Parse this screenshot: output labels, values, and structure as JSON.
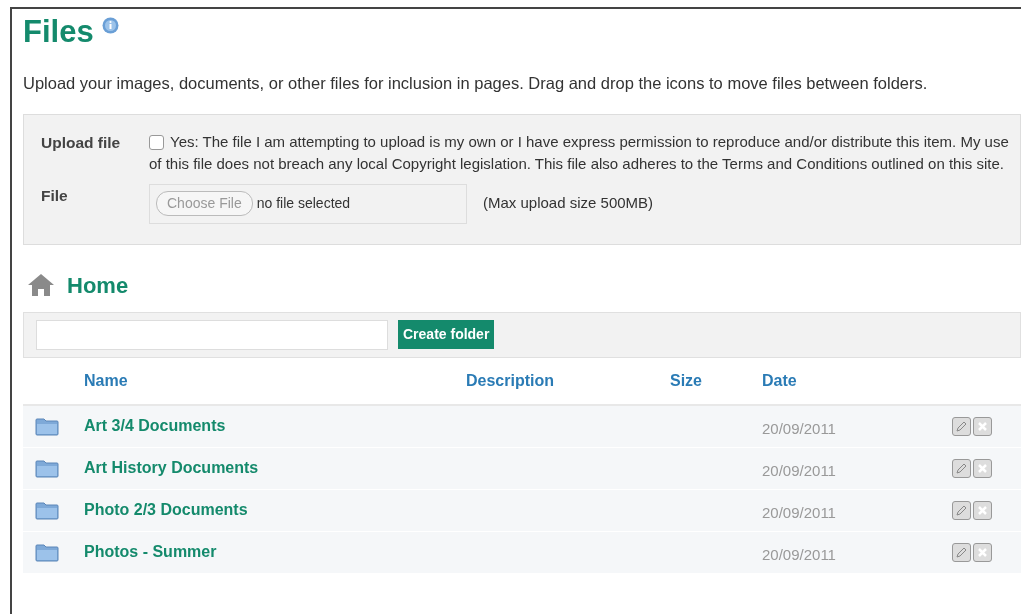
{
  "page": {
    "title": "Files",
    "intro": "Upload your images, documents, or other files for inclusion in pages. Drag and drop the icons to move files between folders."
  },
  "upload": {
    "label": "Upload file",
    "consent": {
      "checked": false,
      "text": "Yes: The file I am attempting to upload is my own or I have express permission to reproduce and/or distribute this item. My use of this file does not breach any local Copyright legislation. This file also adheres to the Terms and Conditions outlined on this site."
    },
    "file_label": "File",
    "choose_button": "Choose File",
    "file_status": "no file selected",
    "max_size": "(Max upload size 500MB)"
  },
  "breadcrumb": {
    "label": "Home"
  },
  "create_folder": {
    "button": "Create folder"
  },
  "table": {
    "columns": [
      "Name",
      "Description",
      "Size",
      "Date"
    ],
    "rows": [
      {
        "name": "Art 3/4 Documents",
        "date": "20/09/2011"
      },
      {
        "name": "Art History Documents",
        "date": "20/09/2011"
      },
      {
        "name": "Photo 2/3 Documents",
        "date": "20/09/2011"
      },
      {
        "name": "Photos - Summer",
        "date": "20/09/2011"
      }
    ]
  }
}
